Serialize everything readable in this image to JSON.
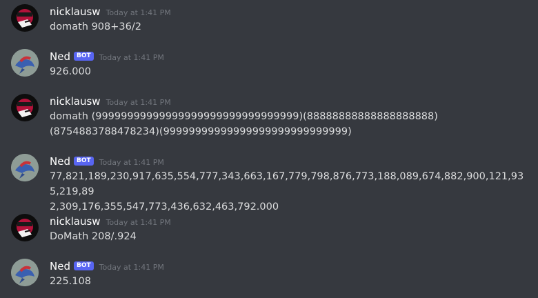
{
  "messages": [
    {
      "author": "nicklausw",
      "timestamp": "Today at 1:41 PM",
      "content": "domath 908+36/2"
    },
    {
      "author": "Ned",
      "bot_tag": "BOT",
      "timestamp": "Today at 1:41 PM",
      "content": "926.000"
    },
    {
      "author": "nicklausw",
      "timestamp": "Today at 1:41 PM",
      "content_lines": [
        "domath (99999999999999999999999999999999)(88888888888888888888)",
        "(8754883788478234)(99999999999999999999999999999)"
      ]
    },
    {
      "author": "Ned",
      "bot_tag": "BOT",
      "timestamp": "Today at 1:41 PM",
      "content_lines": [
        "77,821,189,230,917,635,554,777,343,663,167,779,798,876,773,188,089,674,882,900,121,935,219,89",
        "2,309,176,355,547,773,436,632,463,792.000"
      ]
    },
    {
      "author": "nicklausw",
      "timestamp": "Today at 1:41 PM",
      "content": "DoMath 208/.924"
    },
    {
      "author": "Ned",
      "bot_tag": "BOT",
      "timestamp": "Today at 1:41 PM",
      "content": "225.108"
    }
  ],
  "colors": {
    "background": "#36393f",
    "username": "#ffffff",
    "message_text": "#dcddde",
    "timestamp": "#72767d",
    "bot_tag": "#5865f2"
  },
  "icons": {
    "user_avatar": "user-avatar-icon",
    "bot_avatar": "bot-avatar-icon"
  }
}
